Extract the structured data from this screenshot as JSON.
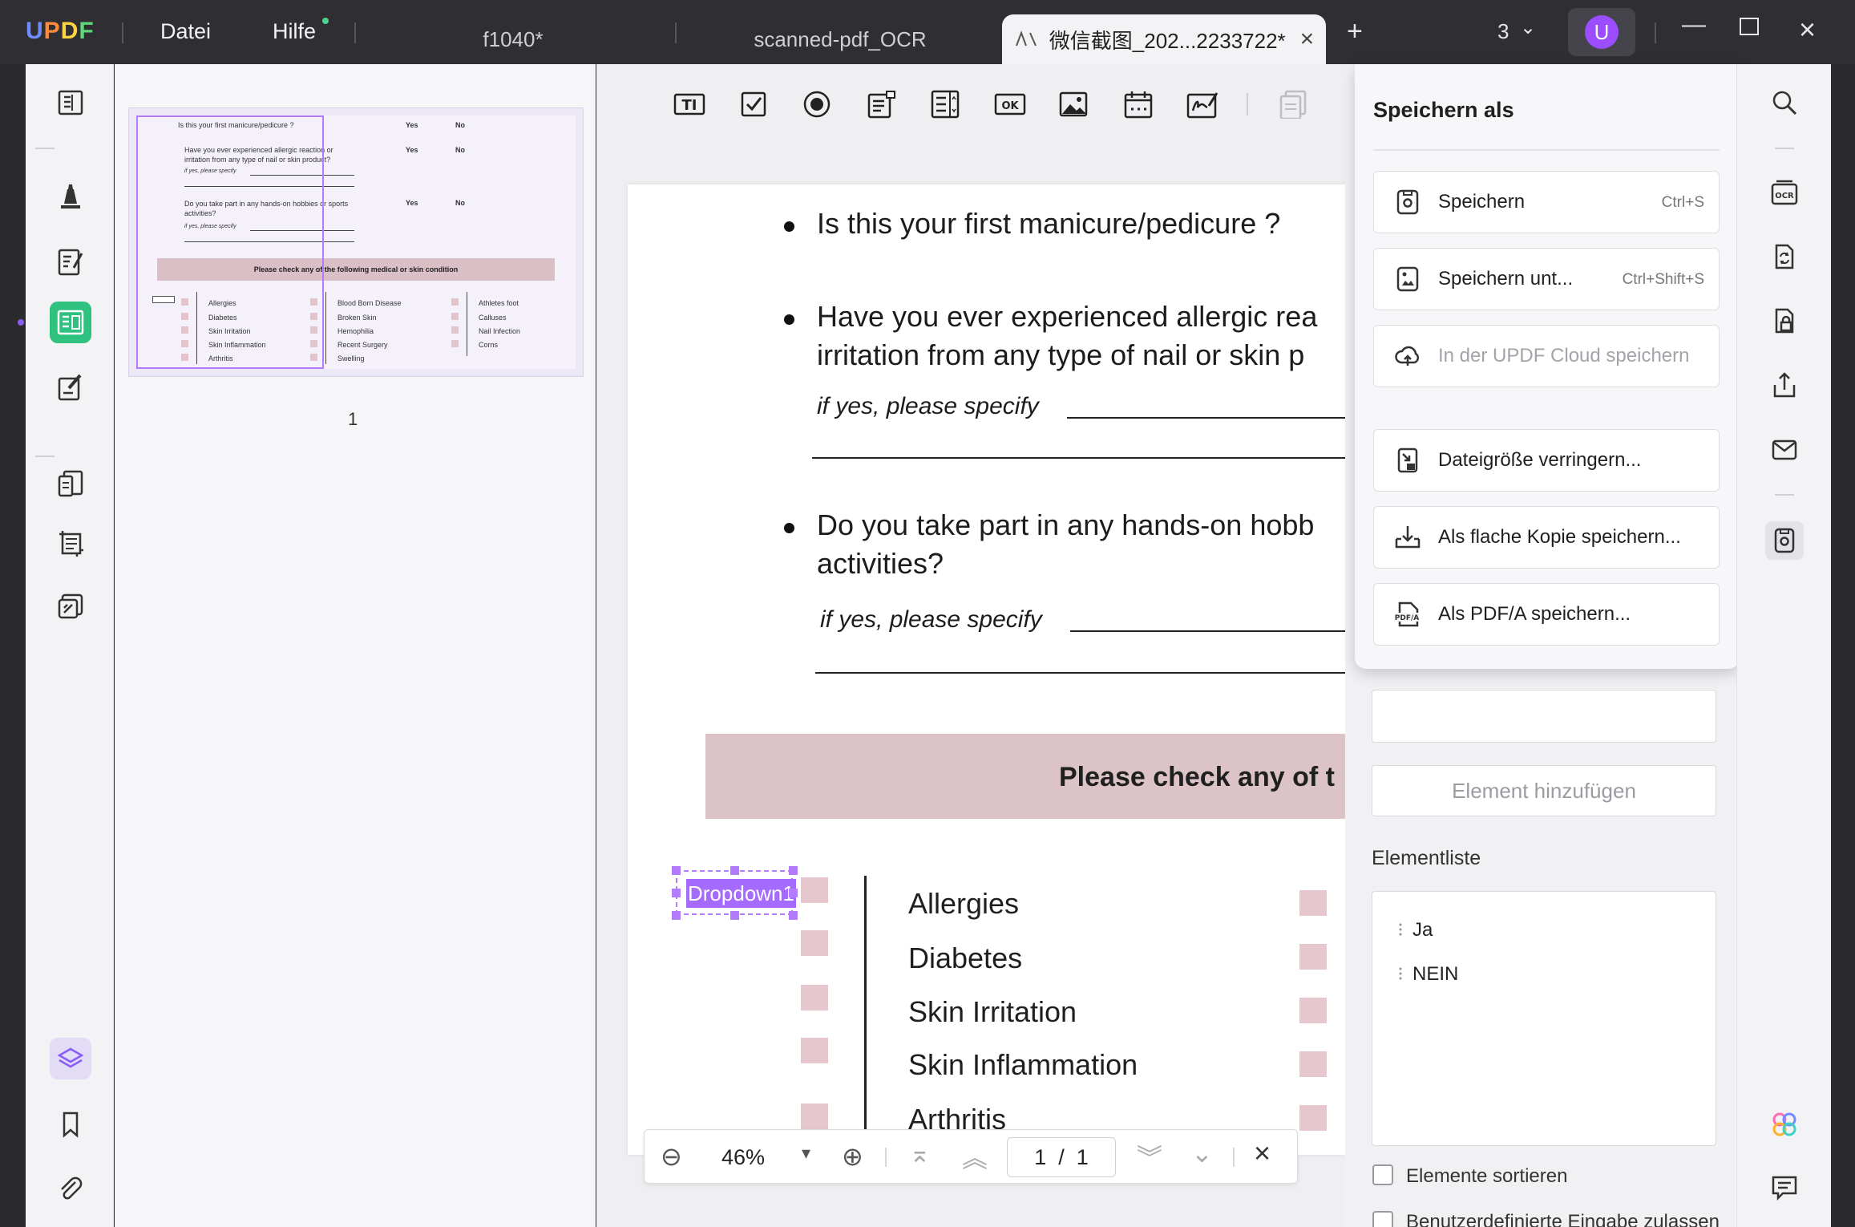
{
  "titlebar": {
    "logo": "UPDF",
    "menu": [
      "Datei",
      "Hilfe"
    ],
    "tabs": [
      "f1040*",
      "scanned-pdf_OCR",
      "微信截图_202...2233722*"
    ],
    "add_tab": "+",
    "tab_count": "3",
    "avatar_letter": "U"
  },
  "thumbnail": {
    "page_number": "1",
    "q1": "Is this your first manicure/pedicure ?",
    "q2a": "Have you ever experienced allergic reaction or",
    "q2b": "irritation from any type of nail or skin product?",
    "q3a": "Do you take part in any hands-on hobbies or sports",
    "q3b": "activities?",
    "specify": "if yes, please specify",
    "yes": "Yes",
    "no": "No",
    "banner": "Please check any of the following medical or skin condition",
    "col1": [
      "Allergies",
      "Diabetes",
      "Skin Irritation",
      "Skin Inflammation",
      "Arthritis"
    ],
    "col2": [
      "Blood Born Disease",
      "Broken Skin",
      "Hemophilia",
      "Recent Surgery",
      "Swelling"
    ],
    "col3": [
      "Athletes foot",
      "Calluses",
      "Nail Infection",
      "Corns"
    ]
  },
  "document": {
    "q1": "Is this your first manicure/pedicure ?",
    "q2_line1": "Have you ever experienced allergic rea",
    "q2_line2": "irritation from any type of nail or skin p",
    "specify": "if yes, please specify",
    "q3_line1": "Do you take part in any hands-on hobb",
    "q3_line2": "activities?",
    "banner": "Please check any of t",
    "conditions": [
      "Allergies",
      "Diabetes",
      "Skin Irritation",
      "Skin Inflammation",
      "Arthritis"
    ],
    "dropdown_label": "Dropdown1"
  },
  "zoombar": {
    "zoom": "46%",
    "page_current": "1",
    "page_sep": "/",
    "page_total": "1"
  },
  "save_popup": {
    "title": "Speichern als",
    "items": [
      {
        "label": "Speichern",
        "shortcut": "Ctrl+S",
        "enabled": true
      },
      {
        "label": "Speichern unt...",
        "shortcut": "Ctrl+Shift+S",
        "enabled": true
      },
      {
        "label": "In der UPDF Cloud speichern",
        "shortcut": "",
        "enabled": false
      },
      {
        "label": "Dateigröße verringern...",
        "shortcut": "",
        "enabled": true
      },
      {
        "label": "Als flache Kopie speichern...",
        "shortcut": "",
        "enabled": true
      },
      {
        "label": "Als PDF/A speichern...",
        "shortcut": "",
        "enabled": true
      }
    ]
  },
  "properties": {
    "add_element": "Element hinzufügen",
    "element_list_title": "Elementliste",
    "elements": [
      "Ja",
      "NEIN"
    ],
    "sort_label": "Elemente sortieren",
    "custom_input_label": "Benutzerdefinierte Eingabe zulassen"
  },
  "colors": {
    "accent": "#2ec27e",
    "selection": "#b37cff",
    "avatar": "#9b4dff",
    "banner": "#dcc3c8"
  }
}
